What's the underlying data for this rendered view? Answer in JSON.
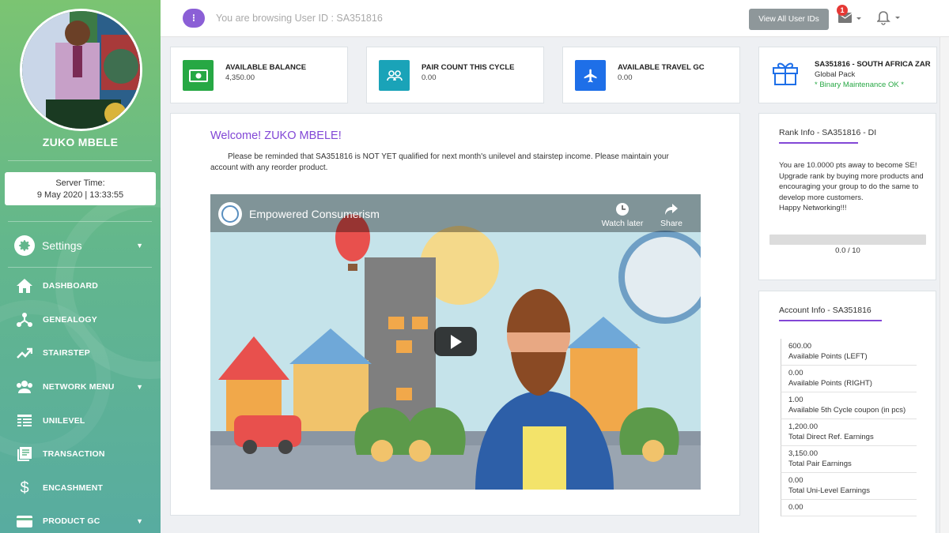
{
  "sidebar": {
    "user_name": "ZUKO  MBELE",
    "server_time_label": "Server Time:",
    "server_time_value": "9 May 2020  |  13:33:55",
    "settings_label": "Settings",
    "items": [
      {
        "label": "DASHBOARD",
        "icon": "home-icon"
      },
      {
        "label": "GENEALOGY",
        "icon": "tree-icon"
      },
      {
        "label": "STAIRSTEP",
        "icon": "trending-up-icon"
      },
      {
        "label": "NETWORK MENU",
        "icon": "users-icon"
      },
      {
        "label": "UNILEVEL",
        "icon": "table-icon"
      },
      {
        "label": "TRANSACTION",
        "icon": "list-icon"
      },
      {
        "label": "ENCASHMENT",
        "icon": "dollar-icon"
      },
      {
        "label": "PRODUCT GC",
        "icon": "card-icon"
      }
    ]
  },
  "topbar": {
    "browse_text": "You are browsing User ID : SA351816",
    "view_all_label": "View All User IDs",
    "mail_badge": "1",
    "info_symbol": "⁝"
  },
  "stats": [
    {
      "label": "AVAILABLE BALANCE",
      "value": "4,350.00",
      "icon": "money-icon",
      "color": "#27a844"
    },
    {
      "label": "PAIR COUNT THIS CYCLE",
      "value": "0.00",
      "icon": "people-icon",
      "color": "#1aa3b8"
    },
    {
      "label": "AVAILABLE TRAVEL GC",
      "value": "0.00",
      "icon": "airplane-icon",
      "color": "#1e6fe8"
    }
  ],
  "pack": {
    "title": "SA351816 - SOUTH AFRICA ZAR",
    "subtitle": "Global Pack",
    "status": "* Binary Maintenance OK *"
  },
  "welcome": {
    "title": "Welcome! ZUKO MBELE!",
    "message": "Please be reminded that SA351816  is NOT YET qualified for next month's unilevel and stairstep income. Please maintain your account with any reorder product."
  },
  "video": {
    "title": "Empowered Consumerism",
    "watch_later": "Watch later",
    "share": "Share"
  },
  "rank": {
    "title": "Rank Info - SA351816 - DI",
    "message": "You are 10.0000 pts away to become SE! Upgrade rank by buying more products and encouraging your group to do the same to develop more customers.",
    "closing": "Happy Networking!!!",
    "progress_text": "0.0 / 10",
    "progress_fraction": 0
  },
  "account": {
    "title": "Account Info - SA351816",
    "rows": [
      {
        "value": "600.00",
        "label": "Available Points (LEFT)"
      },
      {
        "value": "0.00",
        "label": "Available Points (RIGHT)"
      },
      {
        "value": "1.00",
        "label": "Available 5th Cycle coupon (in pcs)"
      },
      {
        "value": "1,200.00",
        "label": "Total Direct Ref. Earnings"
      },
      {
        "value": "3,150.00",
        "label": "Total Pair Earnings"
      },
      {
        "value": "0.00",
        "label": "Total Uni-Level Earnings"
      },
      {
        "value": "0.00",
        "label": ""
      }
    ]
  }
}
